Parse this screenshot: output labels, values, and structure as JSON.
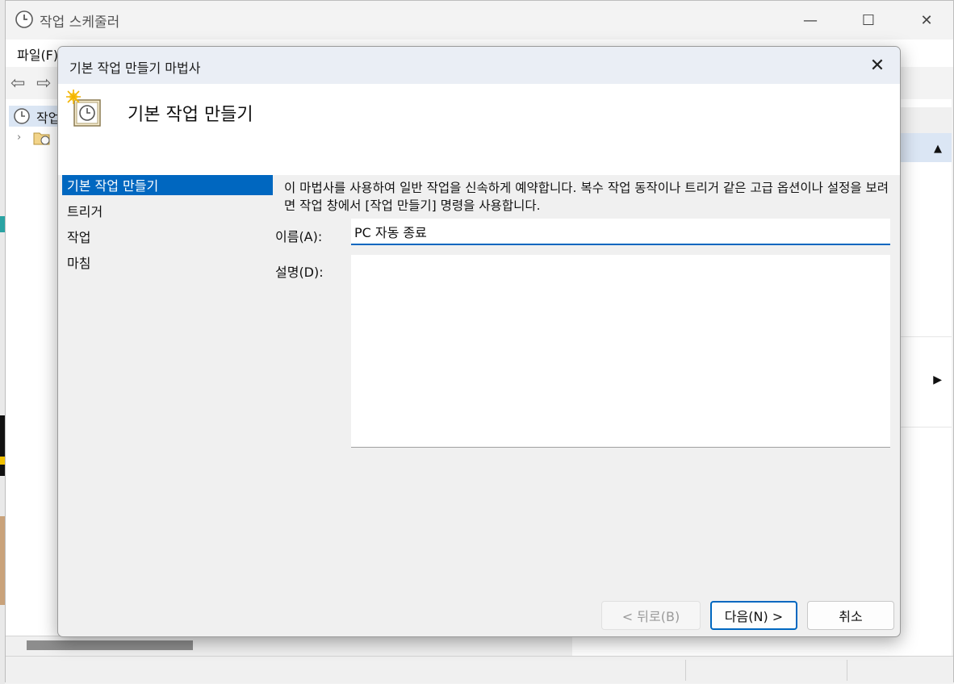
{
  "app": {
    "title": "작업 스케줄러",
    "window_controls": {
      "minimize": "—",
      "maximize": "☐",
      "close": "✕"
    }
  },
  "menubar": {
    "items": [
      "파일(F)"
    ]
  },
  "tree": {
    "root_label": "작업"
  },
  "dialog": {
    "title": "기본 작업 만들기 마법사",
    "heading": "기본 작업 만들기",
    "nav": [
      "기본 작업 만들기",
      "트리거",
      "작업",
      "마침"
    ],
    "selected_nav": 0,
    "description": "이 마법사를 사용하여 일반 작업을 신속하게 예약합니다. 복수 작업 동작이나 트리거 같은 고급 옵션이나 설정을 보려면 작업 창에서 [작업 만들기] 명령을 사용합니다.",
    "fields": {
      "name_label": "이름(A):",
      "name_value": "PC 자동 종료",
      "desc_label": "설명(D):",
      "desc_value": ""
    },
    "buttons": {
      "back": "< 뒤로(B)",
      "next": "다음(N) >",
      "cancel": "취소"
    },
    "colors": {
      "accent": "#0067c0"
    }
  }
}
